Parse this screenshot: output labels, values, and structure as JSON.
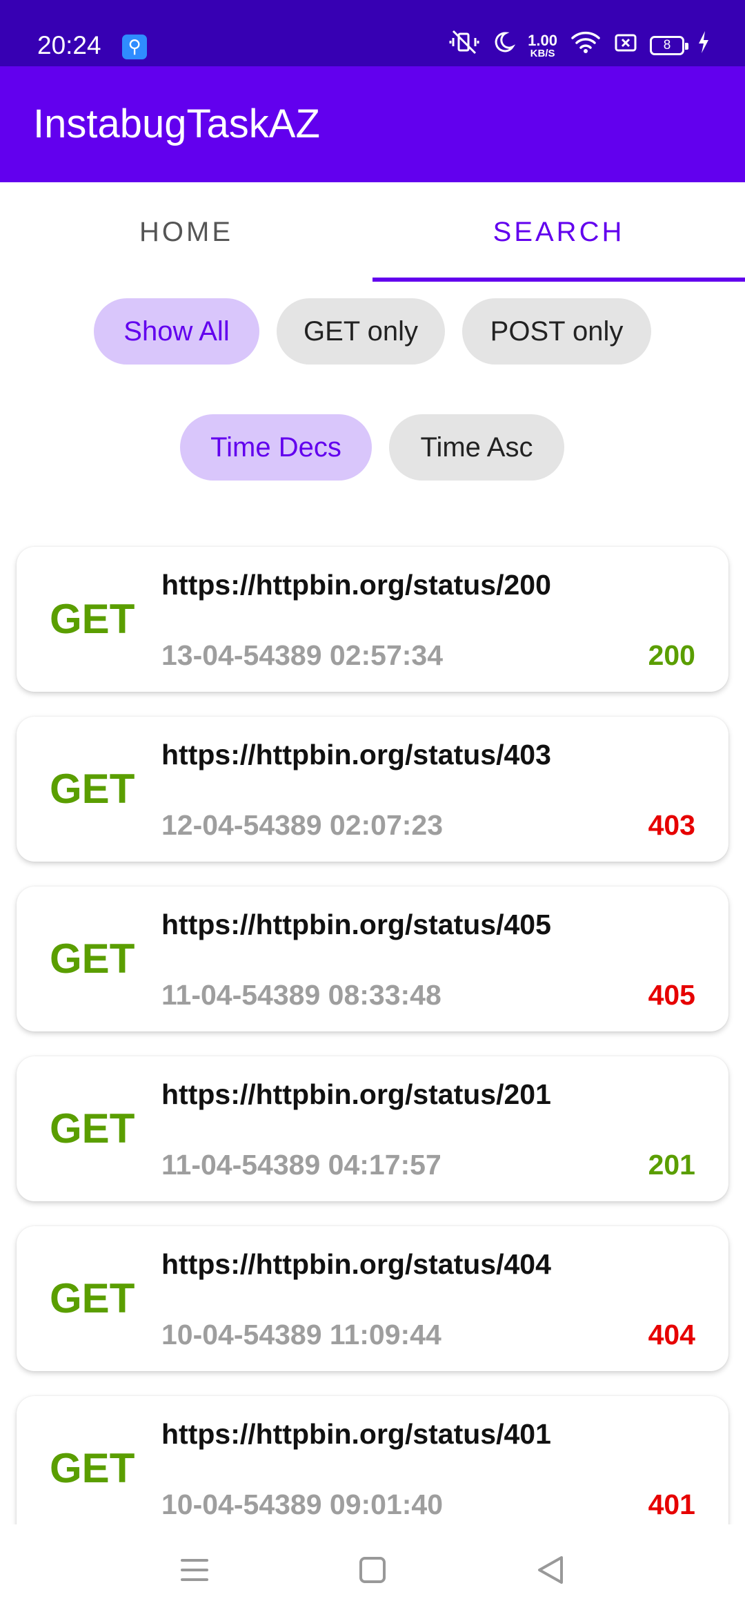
{
  "status_bar": {
    "time": "20:24",
    "usb_icon": "usb-icon",
    "speed_value": "1.00",
    "speed_unit": "KB/S",
    "battery_level": "8",
    "icons": [
      "vibrate-off-icon",
      "moon-icon",
      "wifi-icon",
      "sim-off-icon",
      "battery-icon",
      "charging-icon"
    ]
  },
  "app_bar": {
    "title": "InstabugTaskAZ"
  },
  "tabs": [
    {
      "label": "HOME",
      "active": false
    },
    {
      "label": "SEARCH",
      "active": true
    }
  ],
  "method_filters": [
    {
      "label": "Show All",
      "selected": true
    },
    {
      "label": "GET only",
      "selected": false
    },
    {
      "label": "POST only",
      "selected": false
    }
  ],
  "sort_filters": [
    {
      "label": "Time Decs",
      "selected": true
    },
    {
      "label": "Time Asc",
      "selected": false
    }
  ],
  "requests": [
    {
      "method": "GET",
      "url": "https://httpbin.org/status/200",
      "time": "13-04-54389 02:57:34",
      "code": "200",
      "code_color": "#5a9e00"
    },
    {
      "method": "GET",
      "url": "https://httpbin.org/status/403",
      "time": "12-04-54389 02:07:23",
      "code": "403",
      "code_color": "#e60000"
    },
    {
      "method": "GET",
      "url": "https://httpbin.org/status/405",
      "time": "11-04-54389 08:33:48",
      "code": "405",
      "code_color": "#e60000"
    },
    {
      "method": "GET",
      "url": "https://httpbin.org/status/201",
      "time": "11-04-54389 04:17:57",
      "code": "201",
      "code_color": "#5a9e00"
    },
    {
      "method": "GET",
      "url": "https://httpbin.org/status/404",
      "time": "10-04-54389 11:09:44",
      "code": "404",
      "code_color": "#e60000"
    },
    {
      "method": "GET",
      "url": "https://httpbin.org/status/401",
      "time": "10-04-54389 09:01:40",
      "code": "401",
      "code_color": "#e60000"
    }
  ],
  "colors": {
    "primary": "#6200ee",
    "primary_dark": "#3700b3",
    "chip_selected_bg": "#d9c6fb",
    "method_get": "#5a9e00",
    "success": "#5a9e00",
    "error": "#e60000"
  },
  "nav_bar": {
    "icons": [
      "menu-icon",
      "home-square-icon",
      "back-triangle-icon"
    ]
  }
}
